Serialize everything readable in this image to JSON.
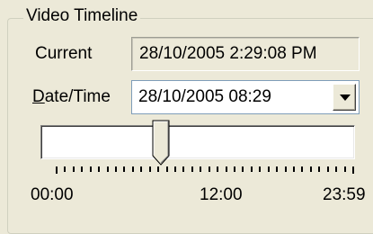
{
  "group": {
    "title": "Video Timeline"
  },
  "current": {
    "label": "Current",
    "value": "28/10/2005 2:29:08 PM"
  },
  "datetime": {
    "label_mnemonic": "D",
    "label_rest": "ate/Time",
    "value": "28/10/2005 08:29"
  },
  "slider": {
    "position_fraction": 0.354,
    "tick_count": 36,
    "labels": [
      "00:00",
      "12:00",
      "23:59"
    ]
  },
  "icons": {
    "dropdown": "chevron-down-icon",
    "thumb": "slider-thumb"
  }
}
